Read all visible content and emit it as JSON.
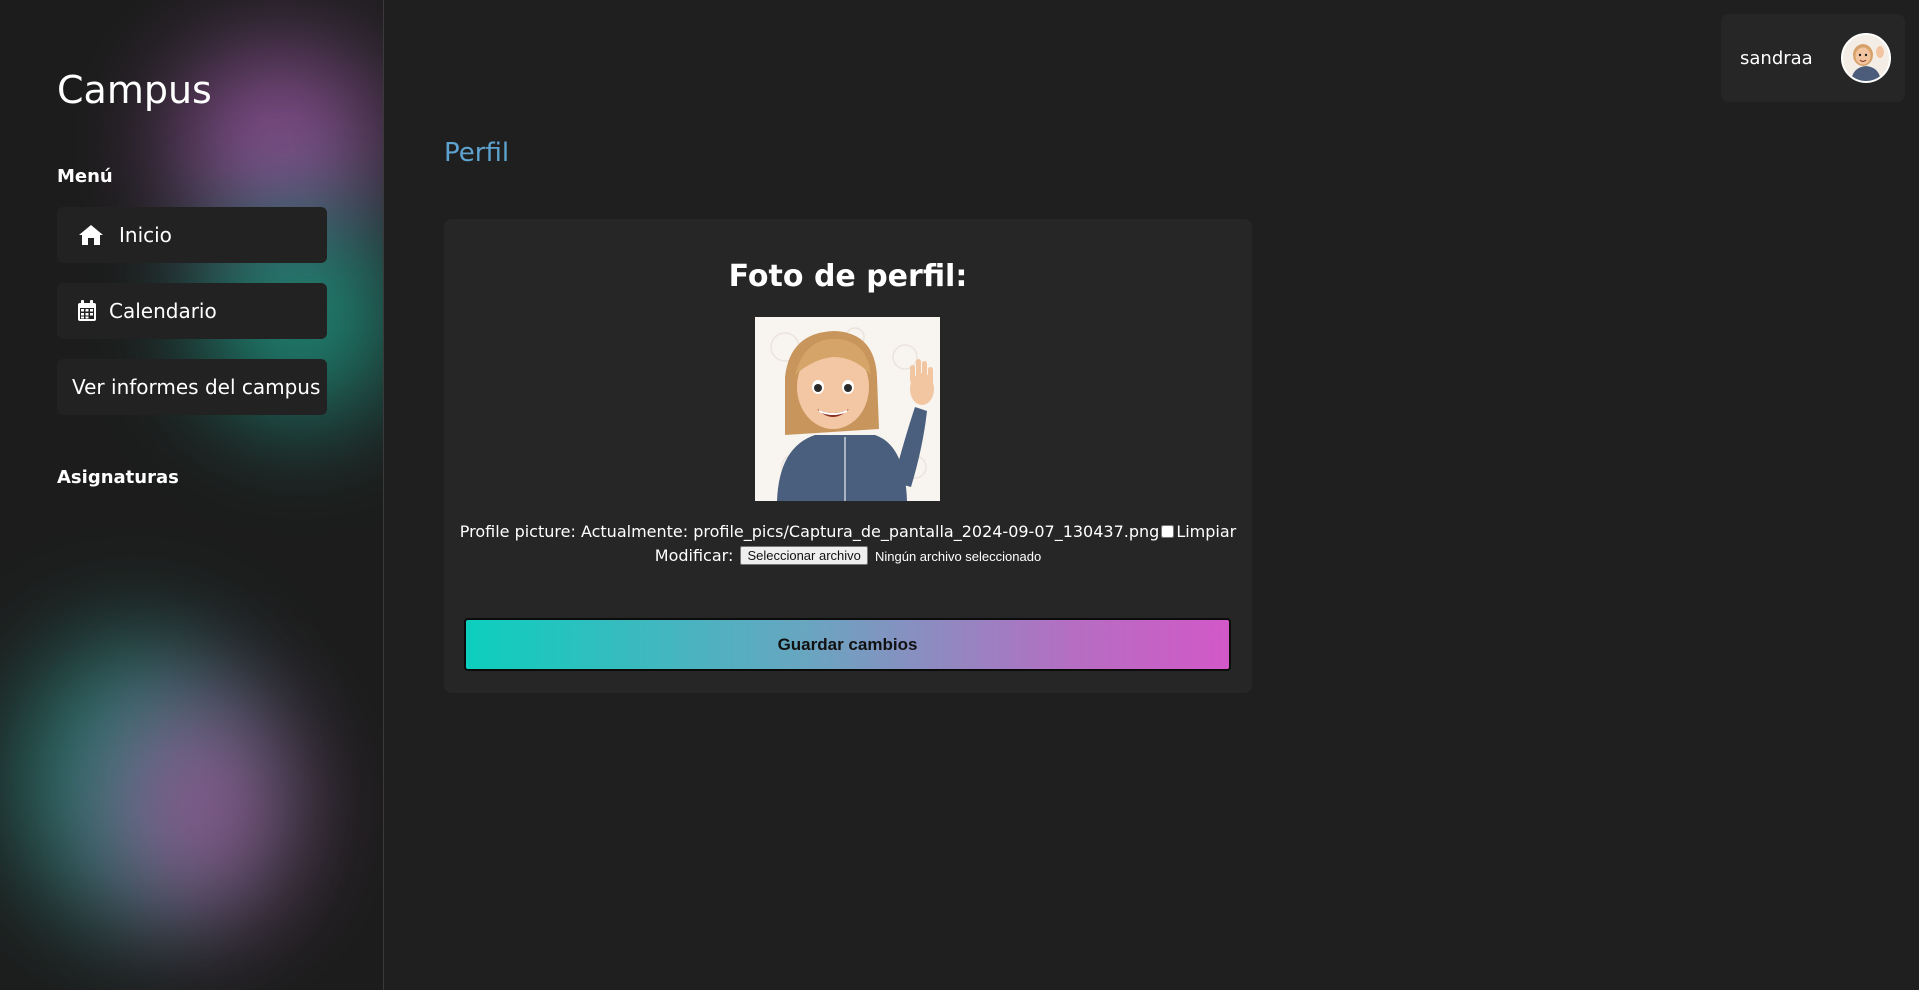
{
  "sidebar": {
    "brand": "Campus",
    "menu_label": "Menú",
    "items": [
      {
        "label": "Inicio",
        "icon": "home-icon"
      },
      {
        "label": "Calendario",
        "icon": "calendar-icon"
      },
      {
        "label": "Ver informes del campus"
      }
    ],
    "subjects_label": "Asignaturas"
  },
  "user": {
    "name": "sandraa"
  },
  "page": {
    "title": "Perfil"
  },
  "profile_form": {
    "heading": "Foto de perfil:",
    "field_label": "Profile picture:",
    "current_label": "Actualmente:",
    "current_value": "profile_pics/Captura_de_pantalla_2024-09-07_130437.png",
    "clear_label": "Limpiar",
    "modify_label": "Modificar:",
    "file_button": "Seleccionar archivo",
    "file_status": "Ningún archivo seleccionado",
    "submit_label": "Guardar cambios"
  },
  "colors": {
    "background": "#1f1f1f",
    "card": "#262626",
    "title_accent": "#5ea3cf",
    "gradient_start": "#0ccfbd",
    "gradient_end": "#d258c8"
  }
}
